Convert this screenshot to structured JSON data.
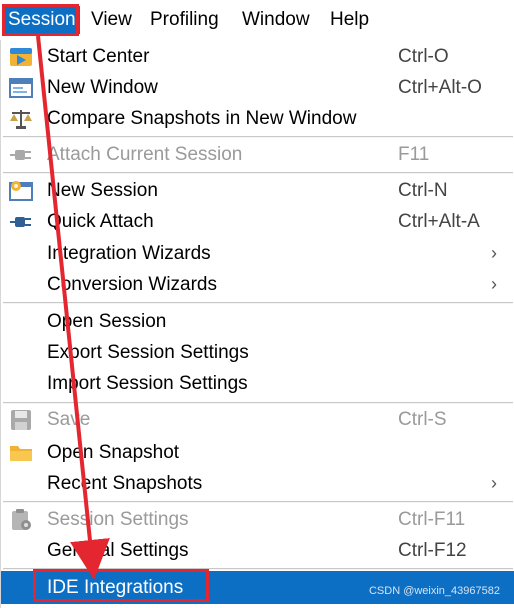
{
  "menubar": {
    "session": "Session",
    "view": "View",
    "profiling": "Profiling",
    "window": "Window",
    "help": "Help"
  },
  "menu": {
    "start_center": {
      "label": "Start Center",
      "shortcut": "Ctrl-O"
    },
    "new_window": {
      "label": "New Window",
      "shortcut": "Ctrl+Alt-O"
    },
    "compare_snapshots": {
      "label": "Compare Snapshots in New Window"
    },
    "attach_current_session": {
      "label": "Attach Current Session",
      "shortcut": "F11"
    },
    "new_session": {
      "label": "New Session",
      "shortcut": "Ctrl-N"
    },
    "quick_attach": {
      "label": "Quick Attach",
      "shortcut": "Ctrl+Alt-A"
    },
    "integration_wizards": {
      "label": "Integration Wizards"
    },
    "conversion_wizards": {
      "label": "Conversion Wizards"
    },
    "open_session": {
      "label": "Open Session"
    },
    "export_session_settings": {
      "label": "Export Session Settings"
    },
    "import_session_settings": {
      "label": "Import Session Settings"
    },
    "save": {
      "label": "Save",
      "shortcut": "Ctrl-S"
    },
    "open_snapshot": {
      "label": "Open Snapshot"
    },
    "recent_snapshots": {
      "label": "Recent Snapshots"
    },
    "session_settings": {
      "label": "Session Settings",
      "shortcut": "Ctrl-F11"
    },
    "general_settings": {
      "label": "General Settings",
      "shortcut": "Ctrl-F12"
    },
    "ide_integrations": {
      "label": "IDE Integrations"
    }
  },
  "watermark": "CSDN @weixin_43967582",
  "colors": {
    "selection": "#0d6fc4",
    "annotation": "#e3262f"
  },
  "icons": {
    "start_center": "start-center-icon",
    "new_window": "new-window-icon",
    "compare_snapshots": "scales-icon",
    "attach_current_session": "plug-icon",
    "new_session": "new-session-icon",
    "quick_attach": "plug-icon",
    "save": "save-icon",
    "open_snapshot": "folder-icon",
    "session_settings": "clipboard-settings-icon"
  }
}
